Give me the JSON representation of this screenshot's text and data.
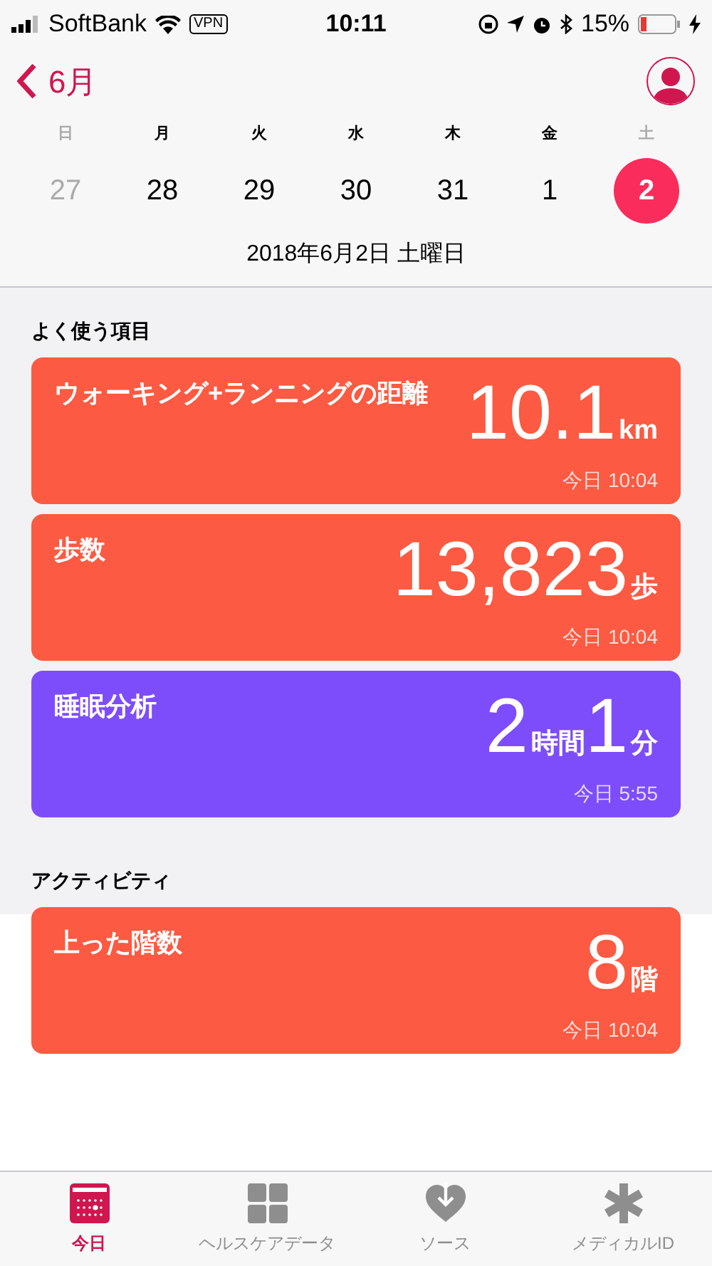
{
  "status_bar": {
    "carrier": "SoftBank",
    "vpn": "VPN",
    "time": "10:11",
    "battery": "15%"
  },
  "nav": {
    "back": "6月"
  },
  "week": {
    "days": [
      {
        "label": "日",
        "weekend": true
      },
      {
        "label": "月",
        "weekend": false
      },
      {
        "label": "火",
        "weekend": false
      },
      {
        "label": "水",
        "weekend": false
      },
      {
        "label": "木",
        "weekend": false
      },
      {
        "label": "金",
        "weekend": false
      },
      {
        "label": "土",
        "weekend": true
      }
    ],
    "dates": [
      {
        "label": "27",
        "other_month": true,
        "selected": false
      },
      {
        "label": "28",
        "other_month": false,
        "selected": false
      },
      {
        "label": "29",
        "other_month": false,
        "selected": false
      },
      {
        "label": "30",
        "other_month": false,
        "selected": false
      },
      {
        "label": "31",
        "other_month": false,
        "selected": false
      },
      {
        "label": "1",
        "other_month": false,
        "selected": false
      },
      {
        "label": "2",
        "other_month": false,
        "selected": true
      }
    ],
    "date_line": "2018年6月2日 土曜日"
  },
  "sections": [
    {
      "title": "よく使う項目",
      "cards": [
        {
          "title": "ウォーキング+ランニングの距離",
          "color": "#fc5a42",
          "value": [
            {
              "kind": "number",
              "text": "10.1"
            },
            {
              "kind": "unit",
              "text": "km"
            }
          ],
          "time": "今日 10:04"
        },
        {
          "title": "歩数",
          "color": "#fc5a42",
          "value": [
            {
              "kind": "number",
              "text": "13,823"
            },
            {
              "kind": "unit",
              "text": "歩"
            }
          ],
          "time": "今日 10:04"
        },
        {
          "title": "睡眠分析",
          "color": "#7d4dfb",
          "value": [
            {
              "kind": "number",
              "text": "2"
            },
            {
              "kind": "unit",
              "text": "時間"
            },
            {
              "kind": "number",
              "text": "1"
            },
            {
              "kind": "unit",
              "text": "分"
            }
          ],
          "time": "今日 5:55"
        }
      ]
    },
    {
      "title": "アクティビティ",
      "cards": [
        {
          "title": "上った階数",
          "color": "#fc5a42",
          "value": [
            {
              "kind": "number",
              "text": "8"
            },
            {
              "kind": "unit",
              "text": "階"
            }
          ],
          "time": "今日 10:04"
        }
      ]
    }
  ],
  "tabs": [
    {
      "label": "今日",
      "selected": true
    },
    {
      "label": "ヘルスケアデータ",
      "selected": false
    },
    {
      "label": "ソース",
      "selected": false
    },
    {
      "label": "メディカルID",
      "selected": false
    }
  ]
}
